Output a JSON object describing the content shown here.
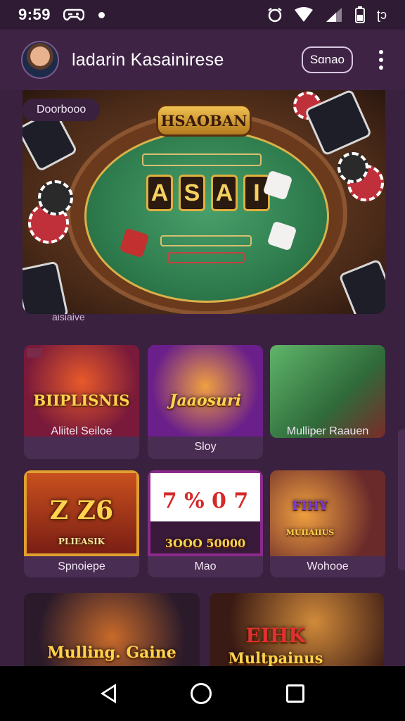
{
  "status_bar": {
    "time": "9:59",
    "right_text": "ʈↄ"
  },
  "header": {
    "title": "ladarin Kasainirese",
    "button_label": "Sɑnao"
  },
  "hero": {
    "chip_label": "Doorbooo",
    "sign_text": "HSAOBAN",
    "tiles": [
      "A",
      "S",
      "A",
      "I"
    ],
    "caption": "aisiaive"
  },
  "games": [
    {
      "art_title": "BIIPLISNIS",
      "label": "Aliitel Seiloe",
      "accent": "#c92a2a"
    },
    {
      "art_title": "Jaaosuri",
      "label": "Sloy",
      "accent": "#7d2fb5"
    },
    {
      "art_title": "",
      "label": "Mulliper Raauen",
      "accent": "#3f8c3f"
    },
    {
      "art_title": "Z Z6",
      "art_subtitle": "PLIEASIK",
      "label": "Spnoiepe",
      "accent": "#b83a18"
    },
    {
      "art_title": "7 % 0 7",
      "art_subtitle": "3OOO 50000",
      "label": "Mao",
      "accent": "#6a1f6e"
    },
    {
      "art_title": "FIHY",
      "art_subtitle": "MUIIAIIUS",
      "label": "Wohooe",
      "accent": "#b9622a"
    },
    {
      "art_title": "Mulling. Gaine",
      "label": "",
      "accent": "#6a3a20"
    },
    {
      "art_title": "Multpainus",
      "art_subtitle": "EIHK",
      "label": "",
      "accent": "#5a2a18"
    }
  ],
  "colors": {
    "background": "#3a2140",
    "header": "#3f2345",
    "card": "#4a2d52",
    "gold": "#ffd34d"
  }
}
